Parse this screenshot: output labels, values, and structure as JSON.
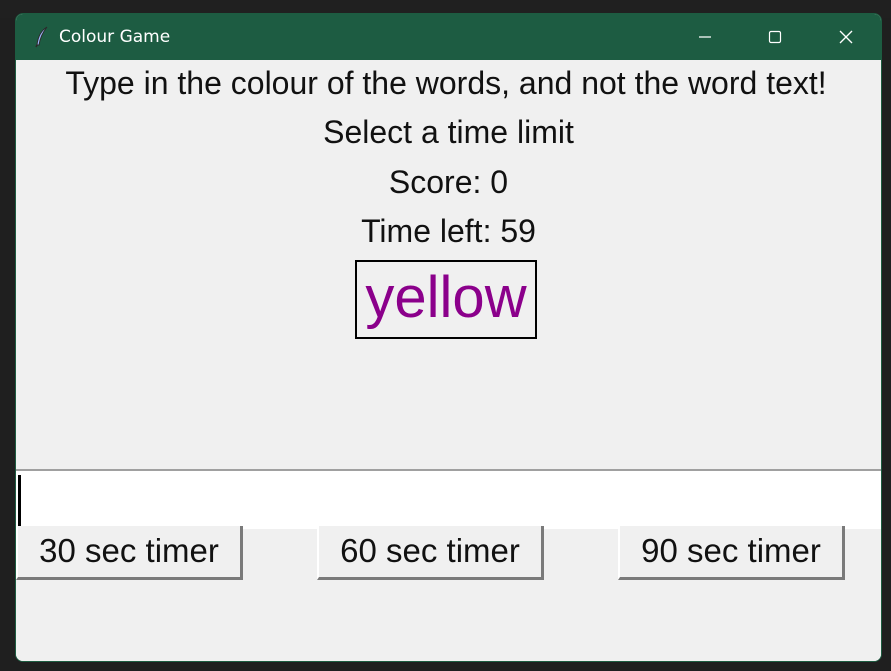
{
  "window": {
    "title": "Colour Game",
    "app_icon": "feather-icon",
    "controls": [
      "minimize-icon",
      "maximize-icon",
      "close-icon"
    ]
  },
  "game": {
    "instructions": "Type in the colour of the words, and not the word text!",
    "prompt": "Select a time limit",
    "score_text": "Score: 0",
    "time_left_text": "Time left: 59",
    "word": "yellow",
    "word_color": "#8b008b"
  },
  "entry": {
    "value": ""
  },
  "buttons": {
    "timer_30": "30 sec timer",
    "timer_60": "60 sec timer",
    "timer_90": "90 sec timer"
  },
  "colors": {
    "titlebar": "#1d5c42",
    "background": "#f0f0f0"
  }
}
